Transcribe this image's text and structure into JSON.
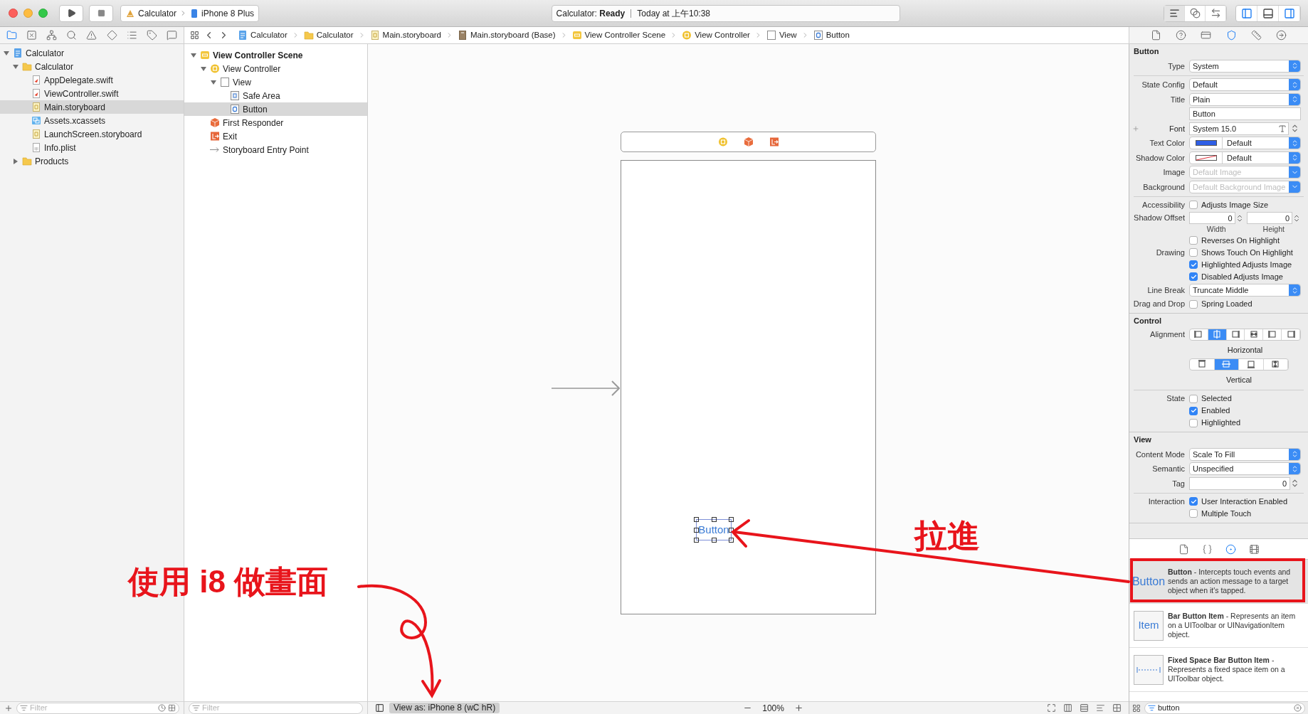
{
  "toolbar": {
    "scheme": "Calculator",
    "device": "iPhone 8 Plus",
    "activity": "Calculator: **Ready**",
    "time": "Today at 上午10:38",
    "editor_modes": [
      {
        "kind": "standard",
        "selected": true
      },
      {
        "kind": "assistant",
        "selected": false
      },
      {
        "kind": "version",
        "selected": false
      }
    ],
    "panels": [
      {
        "kind": "navigator",
        "on": true
      },
      {
        "kind": "debug",
        "on": false
      },
      {
        "kind": "utilities",
        "on": true
      }
    ]
  },
  "navigator_tabs": [
    {
      "kind": "folder",
      "selected": true
    },
    {
      "kind": "source",
      "selected": false
    },
    {
      "kind": "symbol",
      "selected": false
    },
    {
      "kind": "search",
      "selected": false
    },
    {
      "kind": "issue",
      "selected": false
    },
    {
      "kind": "test",
      "selected": false
    },
    {
      "kind": "debug",
      "selected": false
    },
    {
      "kind": "breakpoint",
      "selected": false
    },
    {
      "kind": "report",
      "selected": false
    }
  ],
  "breadcrumb": [
    {
      "kind": "project",
      "label": "Calculator"
    },
    {
      "kind": "folder",
      "label": "Calculator"
    },
    {
      "kind": "storyboard",
      "label": "Main.storyboard"
    },
    {
      "kind": "storyboard-base",
      "label": "Main.storyboard (Base)"
    },
    {
      "kind": "scene",
      "label": "View Controller Scene"
    },
    {
      "kind": "viewcontroller",
      "label": "View Controller"
    },
    {
      "kind": "view",
      "label": "View"
    },
    {
      "kind": "button",
      "label": "Button"
    }
  ],
  "navigator": {
    "items": [
      {
        "label": "Calculator",
        "kind": "project",
        "expanded": true,
        "selected": false,
        "children": [
          {
            "label": "Calculator",
            "kind": "folder",
            "expanded": true,
            "selected": false,
            "children": [
              {
                "label": "AppDelegate.swift",
                "kind": "swift",
                "selected": false
              },
              {
                "label": "ViewController.swift",
                "kind": "swift",
                "selected": false
              },
              {
                "label": "Main.storyboard",
                "kind": "storyboard",
                "selected": true
              },
              {
                "label": "Assets.xcassets",
                "kind": "assets",
                "selected": false
              },
              {
                "label": "LaunchScreen.storyboard",
                "kind": "storyboard",
                "selected": false
              },
              {
                "label": "Info.plist",
                "kind": "plist",
                "selected": false
              }
            ]
          },
          {
            "label": "Products",
            "kind": "folder",
            "expanded": false,
            "selected": false
          }
        ]
      }
    ],
    "filter": {
      "placeholder": "Filter"
    }
  },
  "outline": {
    "items": [
      {
        "label": "View Controller Scene",
        "kind": "scene",
        "expanded": true,
        "selected": false,
        "children": [
          {
            "label": "View Controller",
            "kind": "viewcontroller",
            "expanded": true,
            "selected": false,
            "children": [
              {
                "label": "View",
                "kind": "view",
                "expanded": true,
                "selected": false,
                "children": [
                  {
                    "label": "Safe Area",
                    "kind": "safearea",
                    "selected": false
                  },
                  {
                    "label": "Button",
                    "kind": "button",
                    "selected": true
                  }
                ]
              }
            ]
          },
          {
            "label": "First Responder",
            "kind": "responder",
            "selected": false
          },
          {
            "label": "Exit",
            "kind": "exit",
            "selected": false
          },
          {
            "label": "Storyboard Entry Point",
            "kind": "entry",
            "selected": false
          }
        ]
      }
    ],
    "filter": {
      "placeholder": "Filter"
    }
  },
  "canvas": {
    "button_title": "Button",
    "view_as": "View as: iPhone 8 (wC hR)",
    "zoom": "100%"
  },
  "inspector": {
    "tabs": [
      {
        "kind": "file",
        "selected": false
      },
      {
        "kind": "help",
        "selected": false
      },
      {
        "kind": "identity",
        "selected": false
      },
      {
        "kind": "attributes",
        "selected": true
      },
      {
        "kind": "size",
        "selected": false
      },
      {
        "kind": "connections",
        "selected": false
      }
    ],
    "sections": [
      {
        "title": "Button",
        "rows": [
          {
            "kind": "popup",
            "label": "Type",
            "value": "System"
          },
          {
            "kind": "divider"
          },
          {
            "kind": "popup",
            "label": "State Config",
            "value": "Default"
          },
          {
            "kind": "popup",
            "label": "Title",
            "value": "Plain"
          },
          {
            "kind": "text",
            "value": "Button"
          },
          {
            "kind": "font",
            "label": "Font",
            "value": "System 15.0"
          },
          {
            "kind": "color",
            "label": "Text Color",
            "color": "#2f5fe6",
            "value": "Default"
          },
          {
            "kind": "color",
            "label": "Shadow Color",
            "value": "Default"
          },
          {
            "kind": "popup",
            "label": "Image",
            "placeholder": "Default Image"
          },
          {
            "kind": "popup",
            "label": "Background",
            "placeholder": "Default Background Image"
          },
          {
            "kind": "divider"
          },
          {
            "kind": "check",
            "label": "Accessibility",
            "text": "Adjusts Image Size",
            "checked": false
          },
          {
            "kind": "offset",
            "label": "Shadow Offset",
            "fields": [
              {
                "value": "0",
                "caption": "Width"
              },
              {
                "value": "0",
                "caption": "Height"
              }
            ]
          },
          {
            "kind": "check",
            "text": "Reverses On Highlight",
            "checked": false
          },
          {
            "kind": "check",
            "label": "Drawing",
            "text": "Shows Touch On Highlight",
            "checked": false
          },
          {
            "kind": "check",
            "text": "Highlighted Adjusts Image",
            "checked": true
          },
          {
            "kind": "check",
            "text": "Disabled Adjusts Image",
            "checked": true
          },
          {
            "kind": "popup",
            "label": "Line Break",
            "value": "Truncate Middle"
          },
          {
            "kind": "check",
            "label": "Drag and Drop",
            "text": "Spring Loaded",
            "checked": false
          }
        ]
      },
      {
        "title": "Control",
        "rows": [
          {
            "kind": "segmented",
            "label": "Alignment",
            "caption": "Horizontal",
            "segments": [
              {
                "kind": "left",
                "selected": false
              },
              {
                "kind": "center",
                "selected": true
              },
              {
                "kind": "right",
                "selected": false
              },
              {
                "kind": "fill",
                "selected": false
              },
              {
                "kind": "leading",
                "selected": false
              },
              {
                "kind": "trailing",
                "selected": false
              }
            ]
          },
          {
            "kind": "segmented",
            "caption": "Vertical",
            "segments": [
              {
                "kind": "top",
                "selected": false
              },
              {
                "kind": "middle",
                "selected": true
              },
              {
                "kind": "bottom",
                "selected": false
              },
              {
                "kind": "stretch",
                "selected": false
              }
            ]
          },
          {
            "kind": "divider"
          },
          {
            "kind": "check",
            "label": "State",
            "text": "Selected",
            "checked": false
          },
          {
            "kind": "check",
            "text": "Enabled",
            "checked": true
          },
          {
            "kind": "check",
            "text": "Highlighted",
            "checked": false
          }
        ]
      },
      {
        "title": "View",
        "rows": [
          {
            "kind": "popup",
            "label": "Content Mode",
            "value": "Scale To Fill"
          },
          {
            "kind": "popup",
            "label": "Semantic",
            "value": "Unspecified"
          },
          {
            "kind": "stepper",
            "label": "Tag",
            "value": "0"
          },
          {
            "kind": "divider"
          },
          {
            "kind": "check",
            "label": "Interaction",
            "text": "User Interaction Enabled",
            "checked": true
          },
          {
            "kind": "check",
            "text": "Multiple Touch",
            "checked": false
          }
        ]
      }
    ]
  },
  "library": {
    "tabs": [
      {
        "kind": "file",
        "selected": false
      },
      {
        "kind": "code",
        "selected": false
      },
      {
        "kind": "object",
        "selected": true
      },
      {
        "kind": "media",
        "selected": false
      }
    ],
    "items": [
      {
        "kind": "label",
        "preview_text": "Button",
        "title": "Button",
        "description": "- Intercepts touch events and sends an action message to a target object when it's tapped.",
        "selected": true
      },
      {
        "kind": "boxed",
        "preview_text": "Item",
        "title": "Bar Button Item",
        "description": "- Represents an item on a UIToolbar or UINavigationItem object.",
        "selected": false
      },
      {
        "kind": "space",
        "title": "Fixed Space Bar Button Item",
        "description": "- Represents a fixed space item on a UIToolbar object.",
        "selected": false
      }
    ],
    "search": "button"
  },
  "annotations": {
    "labels": [
      "使用 i8 做畫面",
      "拉進"
    ]
  }
}
